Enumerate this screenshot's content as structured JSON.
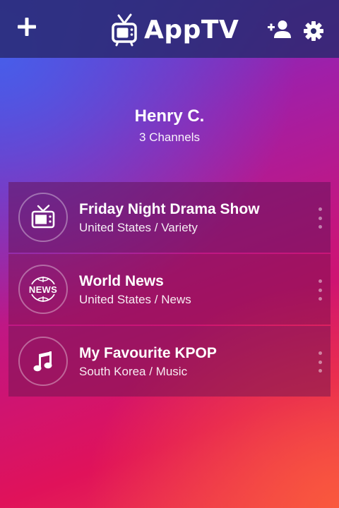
{
  "header": {
    "add_icon": "plus-icon",
    "logo_icon": "tv-icon",
    "brand": "AppTV",
    "add_user_icon": "add-user-icon",
    "settings_icon": "gear-icon",
    "bar_color": "#2b2a6e"
  },
  "profile": {
    "name": "Henry C.",
    "channel_count": "3 Channels"
  },
  "channels": [
    {
      "icon": "tv-icon",
      "title": "Friday Night Drama Show",
      "subtitle": "United States / Variety"
    },
    {
      "icon": "news-icon",
      "icon_text": "NEWS",
      "title": "World News",
      "subtitle": "United States / News"
    },
    {
      "icon": "music-note-icon",
      "title": "My Favourite KPOP",
      "subtitle": "South Korea / Music"
    }
  ],
  "colors": {
    "gradient_start": "#4f63e6",
    "gradient_mid": "#b3168f",
    "gradient_end": "#f2484a"
  }
}
